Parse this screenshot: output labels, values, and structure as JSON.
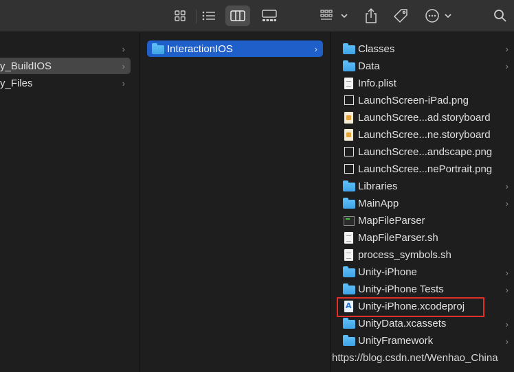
{
  "toolbar": {
    "buttons": [
      "icon-view",
      "list-view",
      "column-view",
      "gallery-view",
      "group-by",
      "share",
      "tags",
      "more-actions",
      "search"
    ]
  },
  "col1": {
    "items": [
      {
        "label": ""
      },
      {
        "label": "y_BuildIOS"
      },
      {
        "label": "y_Files"
      }
    ]
  },
  "col2": {
    "items": [
      {
        "label": "InteractionIOS"
      }
    ]
  },
  "col3": {
    "items": [
      {
        "label": "Classes",
        "icon": "folder"
      },
      {
        "label": "Data",
        "icon": "folder"
      },
      {
        "label": "Info.plist",
        "icon": "document"
      },
      {
        "label": "LaunchScreen-iPad.png",
        "icon": "image"
      },
      {
        "label": "LaunchScree...ad.storyboard",
        "icon": "storyboard"
      },
      {
        "label": "LaunchScree...ne.storyboard",
        "icon": "storyboard"
      },
      {
        "label": "LaunchScree...andscape.png",
        "icon": "image"
      },
      {
        "label": "LaunchScree...nePortrait.png",
        "icon": "image"
      },
      {
        "label": "Libraries",
        "icon": "folder"
      },
      {
        "label": "MainApp",
        "icon": "folder"
      },
      {
        "label": "MapFileParser",
        "icon": "executable"
      },
      {
        "label": "MapFileParser.sh",
        "icon": "document"
      },
      {
        "label": "process_symbols.sh",
        "icon": "document"
      },
      {
        "label": "Unity-iPhone",
        "icon": "folder"
      },
      {
        "label": "Unity-iPhone Tests",
        "icon": "folder"
      },
      {
        "label": "Unity-iPhone.xcodeproj",
        "icon": "xcodeproj"
      },
      {
        "label": "UnityData.xcassets",
        "icon": "folder"
      },
      {
        "label": "UnityFramework",
        "icon": "folder"
      }
    ]
  },
  "watermark": "https://blog.csdn.net/Wenhao_China",
  "colors": {
    "selection_blue": "#1f5fca",
    "highlight_red": "#e0302a",
    "folder_blue": "#4fb2f0"
  }
}
